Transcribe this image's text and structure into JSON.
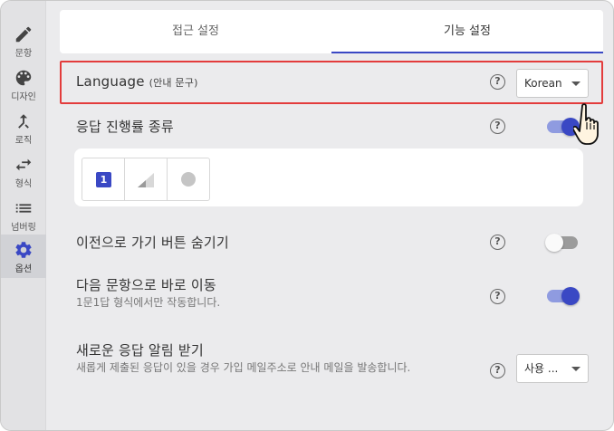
{
  "sidebar": {
    "items": [
      {
        "label": "문항",
        "icon": "pencil-icon"
      },
      {
        "label": "디자인",
        "icon": "palette-icon"
      },
      {
        "label": "로직",
        "icon": "merge-icon"
      },
      {
        "label": "형식",
        "icon": "swap-icon"
      },
      {
        "label": "넘버링",
        "icon": "list-icon"
      },
      {
        "label": "옵션",
        "icon": "gear-icon",
        "active": true
      }
    ]
  },
  "tabs": [
    {
      "label": "접근 설정"
    },
    {
      "label": "기능 설정",
      "active": true
    }
  ],
  "settings": {
    "language": {
      "title": "Language",
      "subtitle": "(안내 문구)",
      "help": "?",
      "value": "Korean"
    },
    "progress": {
      "title": "응답 진행률 종류",
      "help": "?",
      "enabled": true,
      "options": [
        "1"
      ]
    },
    "hide_back": {
      "title": "이전으로 가기 버튼 숨기기",
      "help": "?",
      "enabled": false
    },
    "next_question": {
      "title": "다음 문항으로 바로 이동",
      "desc": "1문1답 형식에서만 작동합니다.",
      "help": "?",
      "enabled": true
    },
    "notify": {
      "title": "새로운 응답 알림 받기",
      "desc": "새롭게 제출된 응답이 있을 경우 가입 메일주소로 안내 메일을 발송합니다.",
      "help": "?",
      "value": "사용 ..."
    }
  },
  "colors": {
    "accent": "#3a48c4",
    "highlight": "#e33c3c",
    "toggle_track_on": "#8f9be0"
  }
}
